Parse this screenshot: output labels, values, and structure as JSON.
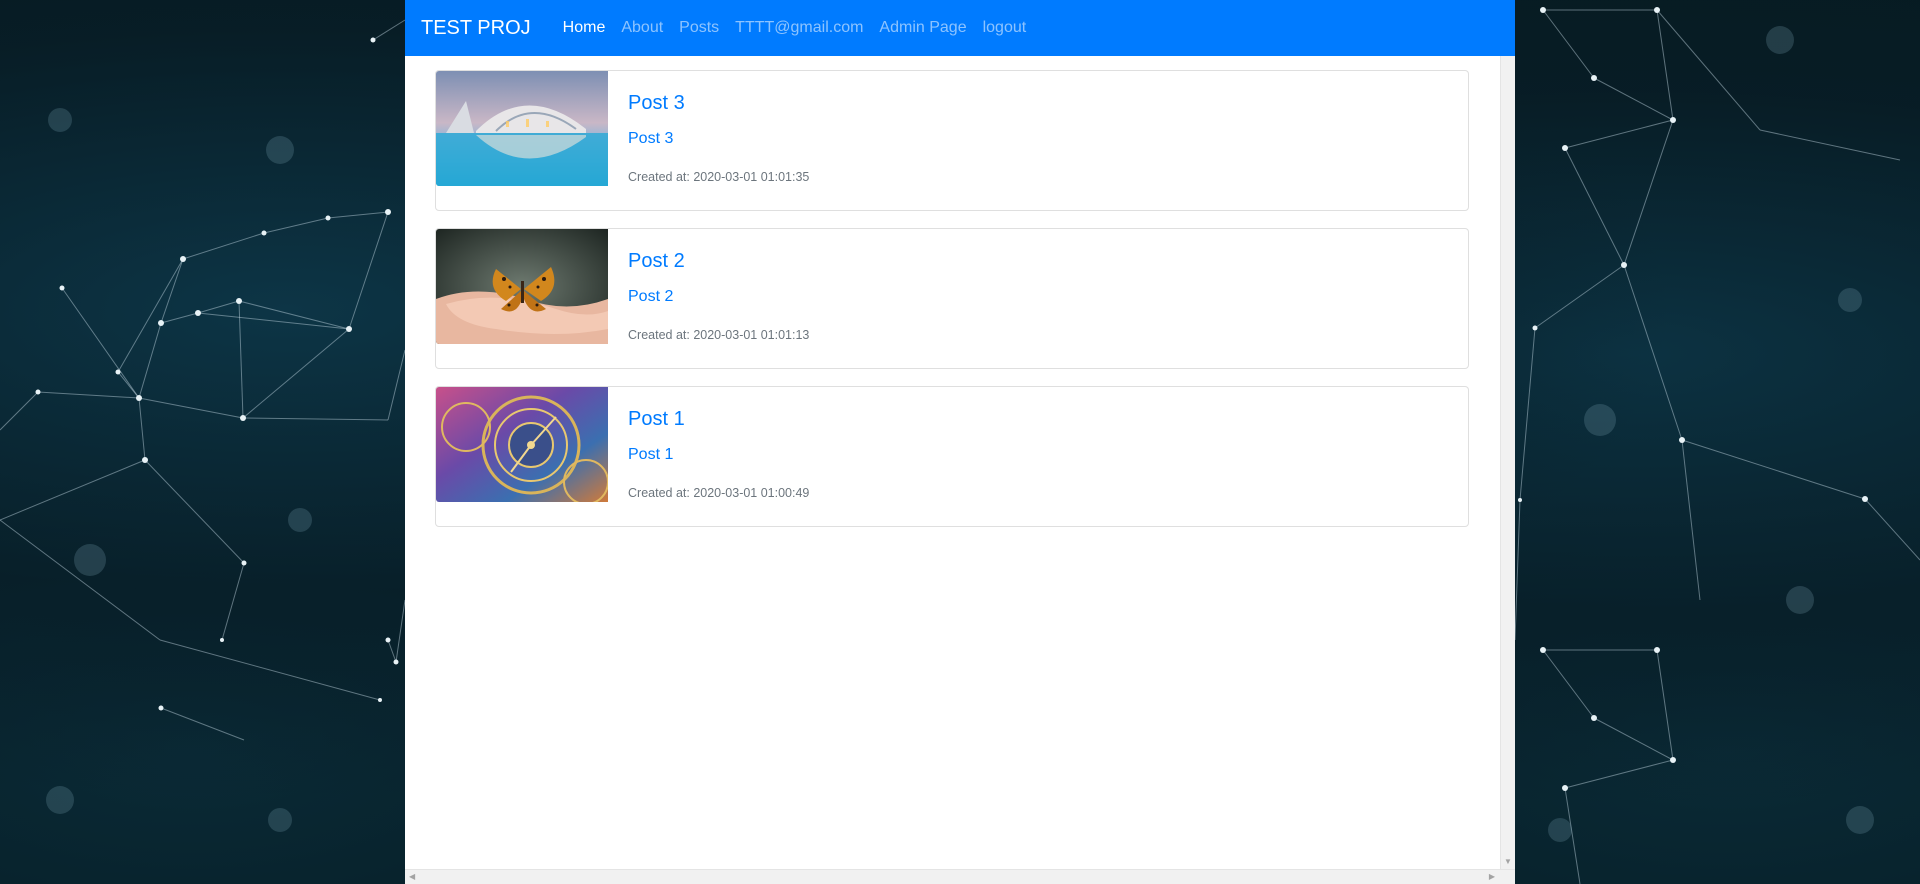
{
  "navbar": {
    "brand": "TEST PROJ",
    "links": [
      {
        "label": "Home",
        "active": true
      },
      {
        "label": "About",
        "active": false
      },
      {
        "label": "Posts",
        "active": false
      },
      {
        "label": "TTTT@gmail.com",
        "active": false
      },
      {
        "label": "Admin Page",
        "active": false
      },
      {
        "label": "logout",
        "active": false
      }
    ]
  },
  "posts": [
    {
      "title": "Post 3",
      "subtitle": "Post 3",
      "created": "Created at: 2020-03-01 01:01:35",
      "image": "building-reflection-image"
    },
    {
      "title": "Post 2",
      "subtitle": "Post 2",
      "created": "Created at: 2020-03-01 01:01:13",
      "image": "butterfly-hands-image"
    },
    {
      "title": "Post 1",
      "subtitle": "Post 1",
      "created": "Created at: 2020-03-01 01:00:49",
      "image": "astronomical-clock-image"
    }
  ],
  "colors": {
    "primary": "#007bff",
    "muted": "#6c757d",
    "background": "#04141a"
  }
}
